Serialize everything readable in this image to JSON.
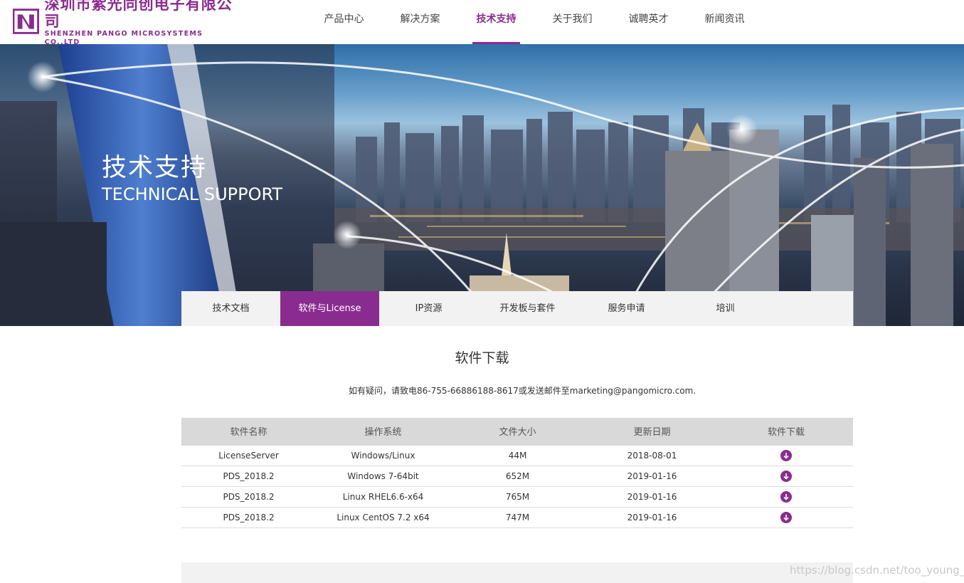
{
  "logo": {
    "name_cn": "深圳市紫光同创电子有限公司",
    "name_en": "SHENZHEN PANGO MICROSYSTEMS CO.,LTD"
  },
  "nav": {
    "items": [
      {
        "label": "产品中心"
      },
      {
        "label": "解决方案"
      },
      {
        "label": "技术支持",
        "active": true
      },
      {
        "label": "关于我们"
      },
      {
        "label": "诚聘英才"
      },
      {
        "label": "新闻资讯"
      }
    ]
  },
  "banner": {
    "title": "技术支持",
    "subtitle": "TECHNICAL SUPPORT"
  },
  "subtabs": [
    {
      "label": "技术文档"
    },
    {
      "label": "软件与License",
      "active": true
    },
    {
      "label": "IP资源"
    },
    {
      "label": "开发板与套件"
    },
    {
      "label": "服务申请"
    },
    {
      "label": "培训"
    }
  ],
  "section": {
    "title": "软件下载",
    "contact": "如有疑问，请致电86-755-66886188-8617或发送邮件至marketing@pangomicro.com."
  },
  "table": {
    "headers": [
      "软件名称",
      "操作系统",
      "文件大小",
      "更新日期",
      "软件下载"
    ],
    "rows": [
      {
        "name": "LicenseServer",
        "os": "Windows/Linux",
        "size": "44M",
        "date": "2018-08-01"
      },
      {
        "name": "PDS_2018.2",
        "os": "Windows 7-64bit",
        "size": "652M",
        "date": "2019-01-16"
      },
      {
        "name": "PDS_2018.2",
        "os": "Linux RHEL6.6-x64",
        "size": "765M",
        "date": "2019-01-16"
      },
      {
        "name": "PDS_2018.2",
        "os": "Linux CentOS 7.2 x64",
        "size": "747M",
        "date": "2019-01-16"
      }
    ]
  },
  "watermark": "https://blog.csdn.net/too_young_z",
  "colors": {
    "brand": "#8a2c8f",
    "tab_bar": "#f2f2f2",
    "table_header": "#d9d9d9"
  },
  "icons": {
    "download": "download-circle-icon",
    "logo": "pango-logo-icon"
  }
}
